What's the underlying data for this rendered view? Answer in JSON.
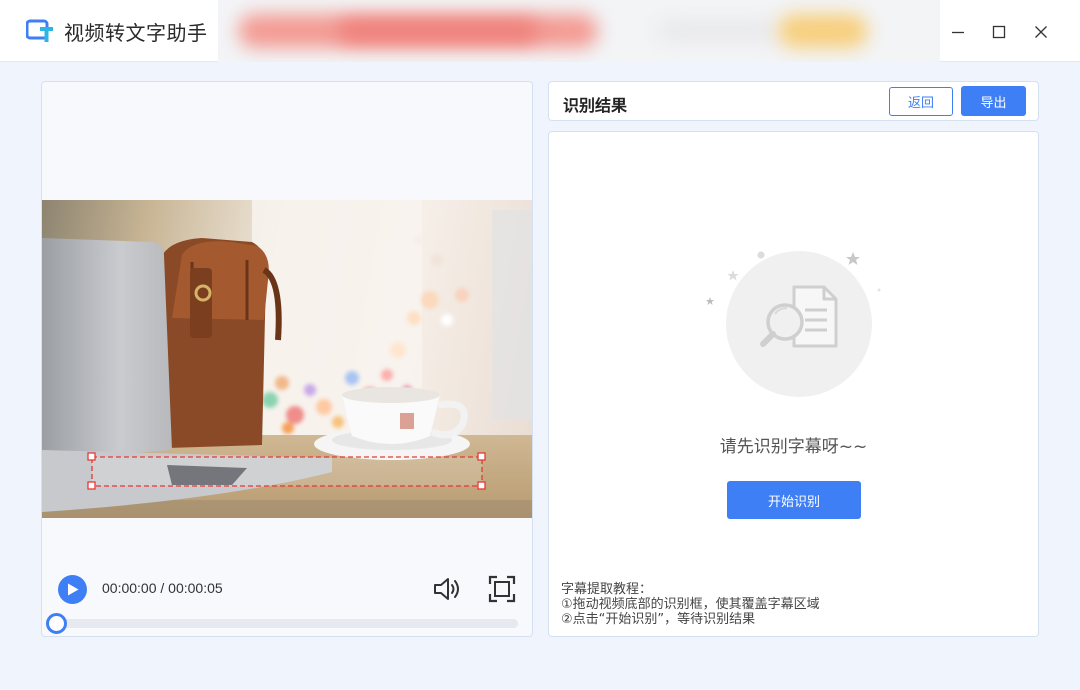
{
  "window": {
    "title": "视频转文字助手",
    "logo_icon": "app-logo-icon",
    "controls": [
      "minimize-icon",
      "maximize-icon",
      "close-icon"
    ]
  },
  "player": {
    "current_time": "00:00:00",
    "separator": " / ",
    "total_time": "00:00:05",
    "progress": 0,
    "icons": [
      "play-icon",
      "volume-icon",
      "fullscreen-icon"
    ]
  },
  "result": {
    "title": "识别结果",
    "back_label": "返回",
    "export_label": "导出",
    "empty_message": "请先识别字幕呀~~",
    "start_label": "开始识别",
    "tutorial": {
      "heading": "字幕提取教程：",
      "step1": "①拖动视频底部的识别框，使其覆盖字幕区域",
      "step2": "②点击“开始识别”，等待识别结果"
    }
  },
  "colors": {
    "accent": "#3f7ff5",
    "background": "#f0f5fd",
    "panel_border": "#d5e1f1",
    "subtitle_box": "#e53935"
  }
}
